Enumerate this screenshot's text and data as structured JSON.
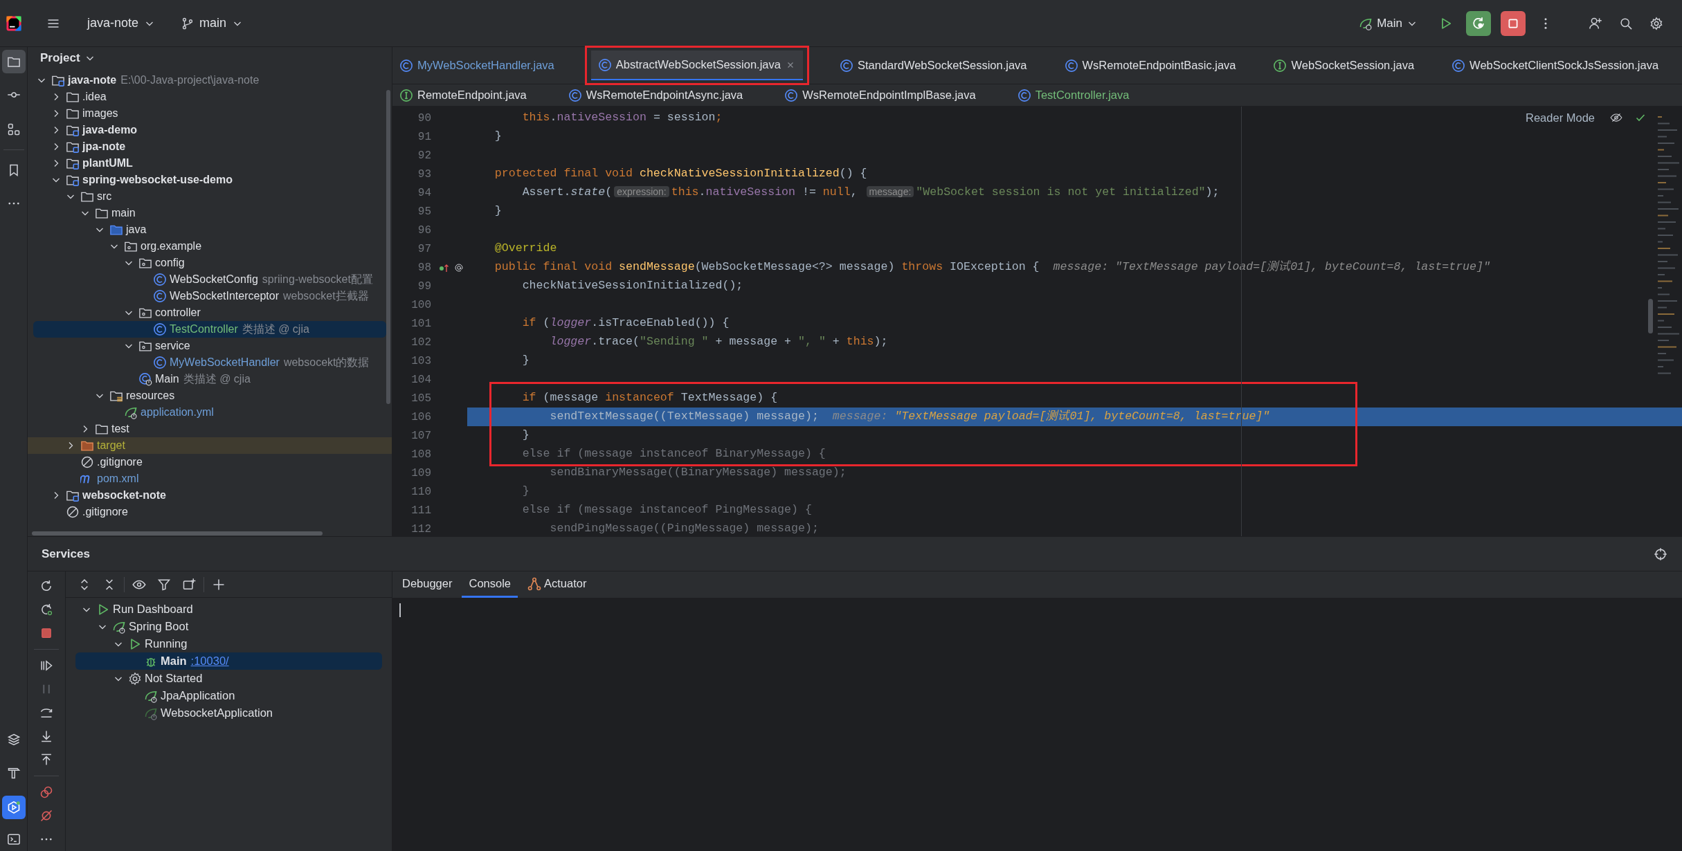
{
  "top_bar": {
    "project": "java-note",
    "branch": "main",
    "run_config": "Main"
  },
  "project": {
    "title": "Project",
    "tree": [
      {
        "name": "java-note",
        "hint": "E:\\00-Java-project\\java-note",
        "kind": "module",
        "color": "#dfe1e5",
        "bold": true,
        "expanded": true,
        "selected": false,
        "children": [
          {
            "name": ".idea",
            "kind": "folder",
            "color": "#dfe1e5",
            "expanded": false,
            "selected": false
          },
          {
            "name": "images",
            "kind": "folder",
            "color": "#dfe1e5",
            "expanded": false,
            "selected": false
          },
          {
            "name": "java-demo",
            "kind": "module",
            "color": "#dfe1e5",
            "bold": true,
            "expanded": false,
            "selected": false
          },
          {
            "name": "jpa-note",
            "kind": "module",
            "color": "#dfe1e5",
            "bold": true,
            "expanded": false,
            "selected": false
          },
          {
            "name": "plantUML",
            "kind": "module",
            "color": "#dfe1e5",
            "bold": true,
            "expanded": false,
            "selected": false
          },
          {
            "name": "spring-websocket-use-demo",
            "kind": "module",
            "color": "#dfe1e5",
            "bold": true,
            "expanded": true,
            "selected": false,
            "children": [
              {
                "name": "src",
                "kind": "folder",
                "color": "#dfe1e5",
                "expanded": true,
                "selected": false,
                "children": [
                  {
                    "name": "main",
                    "kind": "folder",
                    "color": "#dfe1e5",
                    "expanded": true,
                    "selected": false,
                    "children": [
                      {
                        "name": "java",
                        "kind": "sources",
                        "color": "#dfe1e5",
                        "expanded": true,
                        "selected": false,
                        "children": [
                          {
                            "name": "org.example",
                            "kind": "package",
                            "color": "#dfe1e5",
                            "expanded": true,
                            "selected": false,
                            "children": [
                              {
                                "name": "config",
                                "kind": "package",
                                "color": "#dfe1e5",
                                "expanded": true,
                                "selected": false,
                                "children": [
                                  {
                                    "name": "WebSocketConfig",
                                    "hint": "spriing-websocket配置",
                                    "kind": "class",
                                    "color": "#dfe1e5",
                                    "selected": false
                                  },
                                  {
                                    "name": "WebSocketInterceptor",
                                    "hint": "websocket拦截器",
                                    "kind": "class",
                                    "color": "#dfe1e5",
                                    "selected": false
                                  }
                                ]
                              },
                              {
                                "name": "controller",
                                "kind": "package",
                                "color": "#dfe1e5",
                                "expanded": true,
                                "selected": false,
                                "children": [
                                  {
                                    "name": "TestController",
                                    "hint": "类描述 @ cjia",
                                    "kind": "class",
                                    "color": "#73bd79",
                                    "selected": true
                                  }
                                ]
                              },
                              {
                                "name": "service",
                                "kind": "package",
                                "color": "#dfe1e5",
                                "expanded": true,
                                "selected": false,
                                "children": [
                                  {
                                    "name": "MyWebSocketHandler",
                                    "hint": "websocekt的数据",
                                    "kind": "class",
                                    "color": "#6e9fd9",
                                    "selected": false
                                  }
                                ]
                              },
                              {
                                "name": "Main",
                                "hint": "类描述 @ cjia",
                                "kind": "main",
                                "color": "#dfe1e5",
                                "selected": false
                              }
                            ]
                          }
                        ]
                      },
                      {
                        "name": "resources",
                        "kind": "resources",
                        "color": "#dfe1e5",
                        "expanded": true,
                        "selected": false,
                        "children": [
                          {
                            "name": "application.yml",
                            "kind": "spring",
                            "color": "#6e9fd9",
                            "selected": false
                          }
                        ]
                      }
                    ]
                  },
                  {
                    "name": "test",
                    "kind": "folder",
                    "color": "#dfe1e5",
                    "expanded": false,
                    "selected": false
                  }
                ]
              },
              {
                "name": "target",
                "kind": "excluded",
                "color": "#b5b23a",
                "expanded": false,
                "excluded": true,
                "selected": false
              },
              {
                "name": ".gitignore",
                "kind": "ignore",
                "color": "#dfe1e5",
                "selected": false
              },
              {
                "name": "pom.xml",
                "kind": "maven",
                "color": "#6e9fd9",
                "selected": false
              }
            ]
          },
          {
            "name": "websocket-note",
            "kind": "module",
            "color": "#dfe1e5",
            "bold": true,
            "expanded": false,
            "selected": false
          },
          {
            "name": ".gitignore",
            "kind": "ignore",
            "color": "#dfe1e5",
            "selected": false
          }
        ]
      }
    ]
  },
  "editor": {
    "tab_rows": [
      [
        {
          "label": "MyWebSocketHandler.java",
          "kind": "class",
          "color": "#6e9fd9",
          "selected": false
        },
        {
          "label": "AbstractWebSocketSession.java",
          "kind": "class",
          "color": "#dfe1e5",
          "selected": true,
          "boxed": true
        },
        {
          "label": "StandardWebSocketSession.java",
          "kind": "class",
          "color": "#dfe1e5",
          "selected": false
        },
        {
          "label": "WsRemoteEndpointBasic.java",
          "kind": "class",
          "color": "#dfe1e5",
          "selected": false
        },
        {
          "label": "WebSocketSession.java",
          "kind": "interface",
          "color": "#dfe1e5",
          "selected": false
        },
        {
          "label": "WebSocketClientSockJsSession.java",
          "kind": "class",
          "color": "#dfe1e5",
          "selected": false
        }
      ],
      [
        {
          "label": "RemoteEndpoint.java",
          "kind": "interface",
          "color": "#dfe1e5",
          "selected": false
        },
        {
          "label": "WsRemoteEndpointAsync.java",
          "kind": "class",
          "color": "#dfe1e5",
          "selected": false
        },
        {
          "label": "WsRemoteEndpointImplBase.java",
          "kind": "class",
          "color": "#dfe1e5",
          "selected": false
        },
        {
          "label": "TestController.java",
          "kind": "class",
          "color": "#73bd79",
          "selected": false
        }
      ]
    ],
    "reader_mode": "Reader Mode",
    "lines": [
      {
        "number": "90",
        "tokens": [
          {
            "t": "        this",
            "kind": "keyword"
          },
          {
            "t": "."
          },
          {
            "t": "nativeSession",
            "kind": "field"
          },
          {
            "t": " = session"
          },
          {
            "t": ";",
            "kind": "keyword"
          }
        ]
      },
      {
        "number": "91",
        "tokens": [
          {
            "t": "    }"
          }
        ]
      },
      {
        "number": "92"
      },
      {
        "number": "93",
        "tokens": [
          {
            "t": "    protected final void ",
            "kind": "keyword"
          },
          {
            "t": "checkNativeSessionInitialized",
            "kind": "method"
          },
          {
            "t": "() {"
          }
        ]
      },
      {
        "number": "94",
        "tokens": [
          {
            "t": "        Assert."
          },
          {
            "t": "state",
            "kind": "italic"
          },
          {
            "t": "("
          },
          {
            "t": "expression:",
            "kind": "param"
          },
          {
            "t": "this",
            "kind": "keyword"
          },
          {
            "t": "."
          },
          {
            "t": "nativeSession",
            "kind": "field"
          },
          {
            "t": " != "
          },
          {
            "t": "null",
            "kind": "keyword"
          },
          {
            "t": ", "
          },
          {
            "t": "message:",
            "kind": "param"
          },
          {
            "t": "\"WebSocket session is not yet initialized\"",
            "kind": "string"
          },
          {
            "t": ");"
          }
        ]
      },
      {
        "number": "95",
        "tokens": [
          {
            "t": "    }"
          }
        ]
      },
      {
        "number": "96"
      },
      {
        "number": "97",
        "tokens": [
          {
            "t": "    @Override",
            "kind": "annotation"
          }
        ]
      },
      {
        "number": "98",
        "override_marker": true,
        "tokens": [
          {
            "t": "    public final void ",
            "kind": "keyword"
          },
          {
            "t": "sendMessage",
            "kind": "method"
          },
          {
            "t": "(WebSocketMessage<?> message) "
          },
          {
            "t": "throws ",
            "kind": "keyword"
          },
          {
            "t": "IOException {"
          },
          {
            "t": "  message: ",
            "kind": "hint"
          },
          {
            "t": "\"TextMessage payload=[测试01], byteCount=8, last=true]\"",
            "kind": "hint"
          }
        ]
      },
      {
        "number": "99",
        "tokens": [
          {
            "t": "        checkNativeSessionInitialized();"
          }
        ]
      },
      {
        "number": "100"
      },
      {
        "number": "101",
        "tokens": [
          {
            "t": "        if ",
            "kind": "keyword"
          },
          {
            "t": "("
          },
          {
            "t": "logger",
            "kind": "static"
          },
          {
            "t": ".isTraceEnabled()) {"
          }
        ]
      },
      {
        "number": "102",
        "tokens": [
          {
            "t": "            logger",
            "kind": "static"
          },
          {
            "t": ".trace("
          },
          {
            "t": "\"Sending \"",
            "kind": "string"
          },
          {
            "t": " + message + "
          },
          {
            "t": "\", \"",
            "kind": "string"
          },
          {
            "t": " + "
          },
          {
            "t": "this",
            "kind": "keyword"
          },
          {
            "t": ");"
          }
        ]
      },
      {
        "number": "103",
        "tokens": [
          {
            "t": "        }"
          }
        ]
      },
      {
        "number": "104"
      },
      {
        "number": "105",
        "boxed": true,
        "tokens": [
          {
            "t": "        if ",
            "kind": "keyword"
          },
          {
            "t": "(message "
          },
          {
            "t": "instanceof ",
            "kind": "keyword"
          },
          {
            "t": "TextMessage) {"
          }
        ]
      },
      {
        "number": "106",
        "boxed": true,
        "current": true,
        "tokens": [
          {
            "t": "            sendTextMessage((TextMessage) message);"
          },
          {
            "t": "  message: ",
            "kind": "hint"
          },
          {
            "t": "\"TextMessage payload=[测试01], byteCount=8, last=true]\"",
            "kind": "value"
          }
        ]
      },
      {
        "number": "107",
        "boxed": true,
        "tokens": [
          {
            "t": "        }"
          }
        ]
      },
      {
        "number": "108",
        "boxed": true,
        "tokens": [
          {
            "t": "        else if (message instanceof BinaryMessage) {",
            "kind": "dim"
          }
        ]
      },
      {
        "number": "109",
        "tokens": [
          {
            "t": "            sendBinaryMessage((BinaryMessage) message);",
            "kind": "dim"
          }
        ]
      },
      {
        "number": "110",
        "tokens": [
          {
            "t": "        }",
            "kind": "dim"
          }
        ]
      },
      {
        "number": "111",
        "tokens": [
          {
            "t": "        else if (message instanceof PingMessage) {",
            "kind": "dim"
          }
        ]
      },
      {
        "number": "112",
        "tokens": [
          {
            "t": "            sendPingMessage((PingMessage) message);",
            "kind": "dim"
          }
        ]
      }
    ]
  },
  "services": {
    "title": "Services",
    "tree": [
      {
        "label": "Run Dashboard",
        "kind": "run",
        "expanded": true,
        "selected": false,
        "children": [
          {
            "label": "Spring Boot",
            "kind": "spring",
            "expanded": true,
            "selected": false,
            "children": [
              {
                "label": "Running",
                "kind": "run",
                "expanded": true,
                "selected": false,
                "children": [
                  {
                    "label": "Main",
                    "link": ":10030/",
                    "kind": "debug",
                    "selected": true
                  }
                ]
              },
              {
                "label": "Not Started",
                "kind": "settings",
                "expanded": true,
                "selected": false,
                "children": [
                  {
                    "label": "JpaApplication",
                    "kind": "spring",
                    "selected": false
                  },
                  {
                    "label": "WebsocketApplication",
                    "kind": "dormant",
                    "selected": false
                  }
                ]
              }
            ]
          }
        ]
      }
    ],
    "console_tabs": [
      {
        "label": "Debugger",
        "kind": "plain",
        "selected": false
      },
      {
        "label": "Console",
        "kind": "plain",
        "selected": true
      },
      {
        "label": "Actuator",
        "kind": "actuator",
        "selected": false
      }
    ]
  }
}
